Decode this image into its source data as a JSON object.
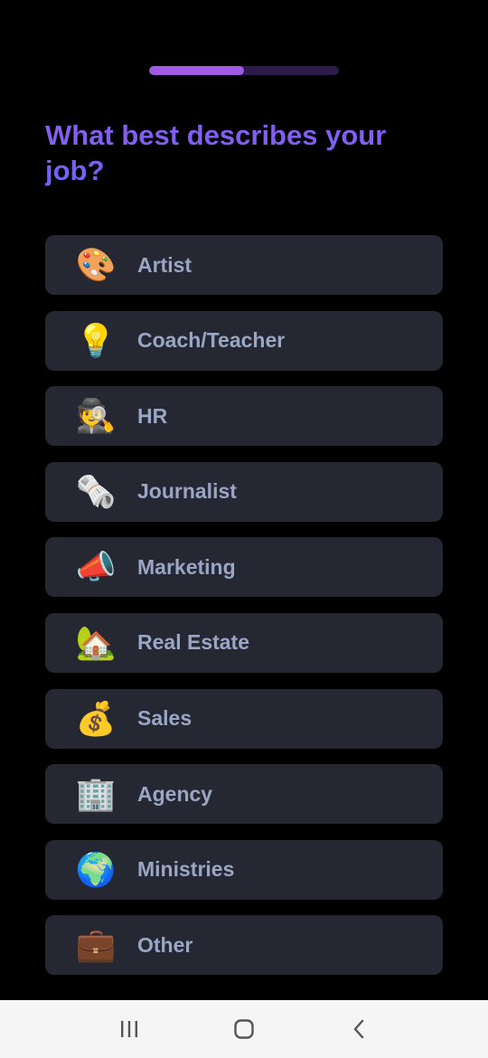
{
  "progress": {
    "fraction": 0.5,
    "fill_color": "#a259e6",
    "track_color": "#2c1a4a"
  },
  "header": {
    "title": "What best describes your job?"
  },
  "options": [
    {
      "label": "Artist",
      "icon": "artist-palette-icon",
      "emoji": "🎨"
    },
    {
      "label": "Coach/Teacher",
      "icon": "light-bulb-icon",
      "emoji": "💡"
    },
    {
      "label": "HR",
      "icon": "detective-icon",
      "emoji": "🕵️"
    },
    {
      "label": "Journalist",
      "icon": "rolled-newspaper-icon",
      "emoji": "🗞️"
    },
    {
      "label": "Marketing",
      "icon": "megaphone-icon",
      "emoji": "📣"
    },
    {
      "label": "Real Estate",
      "icon": "house-with-garden-icon",
      "emoji": "🏡"
    },
    {
      "label": "Sales",
      "icon": "money-bag-icon",
      "emoji": "💰"
    },
    {
      "label": "Agency",
      "icon": "office-building-icon",
      "emoji": "🏢"
    },
    {
      "label": "Ministries",
      "icon": "globe-icon",
      "emoji": "🌍"
    },
    {
      "label": "Other",
      "icon": "briefcase-icon",
      "emoji": "💼"
    }
  ],
  "navbar": {
    "recent_icon": "recent-apps-icon",
    "home_icon": "home-icon",
    "back_icon": "back-icon"
  }
}
